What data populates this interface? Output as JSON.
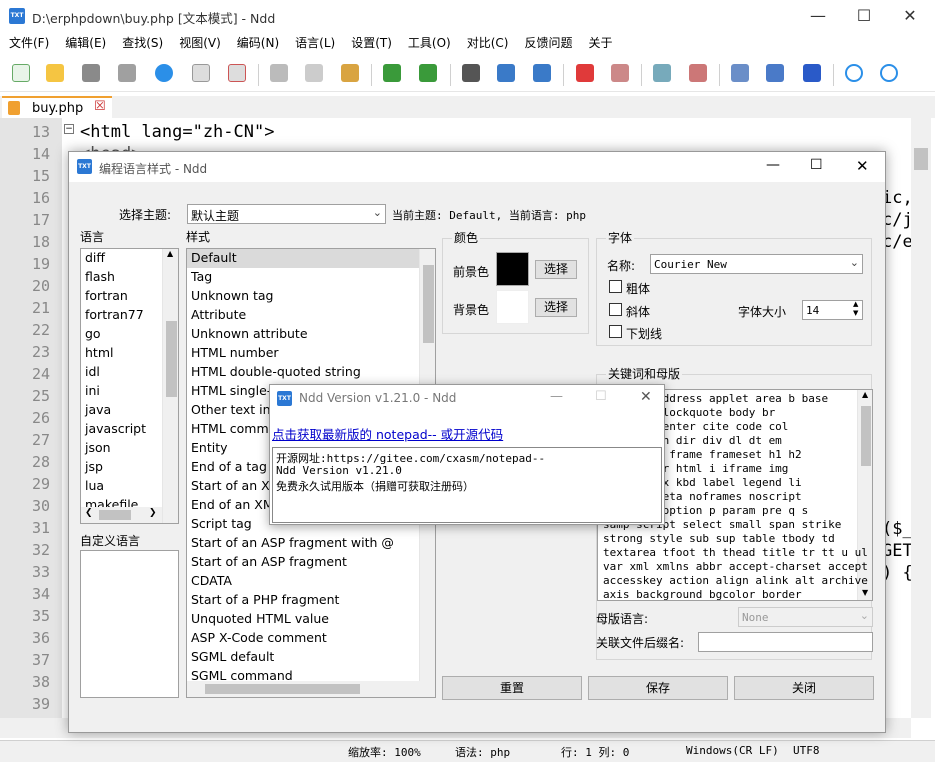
{
  "window": {
    "title": "D:\\erphpdown\\buy.php [文本模式] - Ndd",
    "icon_text": "TXT"
  },
  "menu": [
    "文件(F)",
    "编辑(E)",
    "查找(S)",
    "视图(V)",
    "编码(N)",
    "语言(L)",
    "设置(T)",
    "工具(O)",
    "对比(C)",
    "反馈问题",
    "关于"
  ],
  "tab": {
    "label": "buy.php"
  },
  "editor": {
    "lines": [
      "13",
      "14",
      "15",
      "16",
      "17",
      "18",
      "19",
      "20",
      "21",
      "22",
      "23",
      "24",
      "25",
      "26",
      "27",
      "28",
      "29",
      "30",
      "31",
      "32",
      "33",
      "34",
      "35",
      "36",
      "37",
      "38",
      "39"
    ],
    "line13_code": "<html lang=\"zh-CN\">",
    "line14_code": "<head>",
    "right_fragments": [
      "ic,",
      "c/j",
      "c/e",
      "($_",
      "GET",
      ") {"
    ]
  },
  "status": {
    "zoom": "缩放率: 100%",
    "lang": "语法: php",
    "pos": "行: 1 列: 0",
    "eol": "Windows(CR LF)",
    "encoding": "UTF8"
  },
  "dialog": {
    "title": "编程语言样式 - Ndd",
    "theme_label": "选择主题:",
    "theme_value": "默认主题",
    "current": "当前主题: Default, 当前语言: php",
    "lang_label": "语言",
    "style_label": "样式",
    "languages": [
      "diff",
      "flash",
      "fortran",
      "fortran77",
      "go",
      "html",
      "idl",
      "ini",
      "java",
      "javascript",
      "json",
      "jsp",
      "lua",
      "makefile"
    ],
    "custom_lang_label": "自定义语言",
    "styles": [
      "Default",
      "Tag",
      "Unknown tag",
      "Attribute",
      "Unknown attribute",
      "HTML number",
      "HTML double-quoted string",
      "HTML single-",
      "Other text in a",
      "HTML comme",
      "Entity",
      "End of a tag",
      "Start of an XM",
      "End of an XM",
      "Script tag",
      "Start of an ASP fragment with @",
      "Start of an ASP fragment",
      "CDATA",
      "Start of a PHP fragment",
      "Unquoted HTML value",
      "ASP X-Code comment",
      "SGML default",
      "SGML command"
    ],
    "color_group": "颜色",
    "fg_label": "前景色",
    "bg_label": "背景色",
    "select_btn": "选择",
    "fg_color": "#000000",
    "bg_color": "#ffffff",
    "font_group": "字体",
    "font_name_label": "名称:",
    "font_name": "Courier New",
    "bold": "粗体",
    "italic": "斜体",
    "underline": "下划线",
    "font_size_label": "字体大小",
    "font_size": "14",
    "keywords_group": "关键词和母版",
    "keywords": [
      "acronym address applet area b base",
      "bdo big blockquote body br",
      "caption center cite code col",
      "dd del dfn dir div dl dt em",
      "font form frame frameset h1 h2",
      "h6 head hr html i iframe img",
      "ut isindex kbd label legend li",
      "nk menu meta noframes noscript",
      "optgroup option p param pre q s",
      "samp script select small span strike",
      "strong style sub sup table tbody td",
      "textarea tfoot th thead title tr tt u ul",
      "var xml xmlns abbr accept-charset accept",
      "accesskey action align alink alt archive",
      "axis background bgcolor border"
    ],
    "master_label": "母版语言:",
    "master_value": "None",
    "ext_label": "关联文件后缀名:",
    "reset_btn": "重置",
    "save_btn": "保存",
    "close_btn": "关闭"
  },
  "about": {
    "title": "Ndd Version v1.21.0 - Ndd",
    "link": "点击获取最新版的 notepad-- 或开源代码",
    "lines": [
      "开源网址:https://gitee.com/cxasm/notepad--",
      "Ndd Version v1.21.0",
      "免费永久试用版本（捐赠可获取注册码）"
    ]
  }
}
